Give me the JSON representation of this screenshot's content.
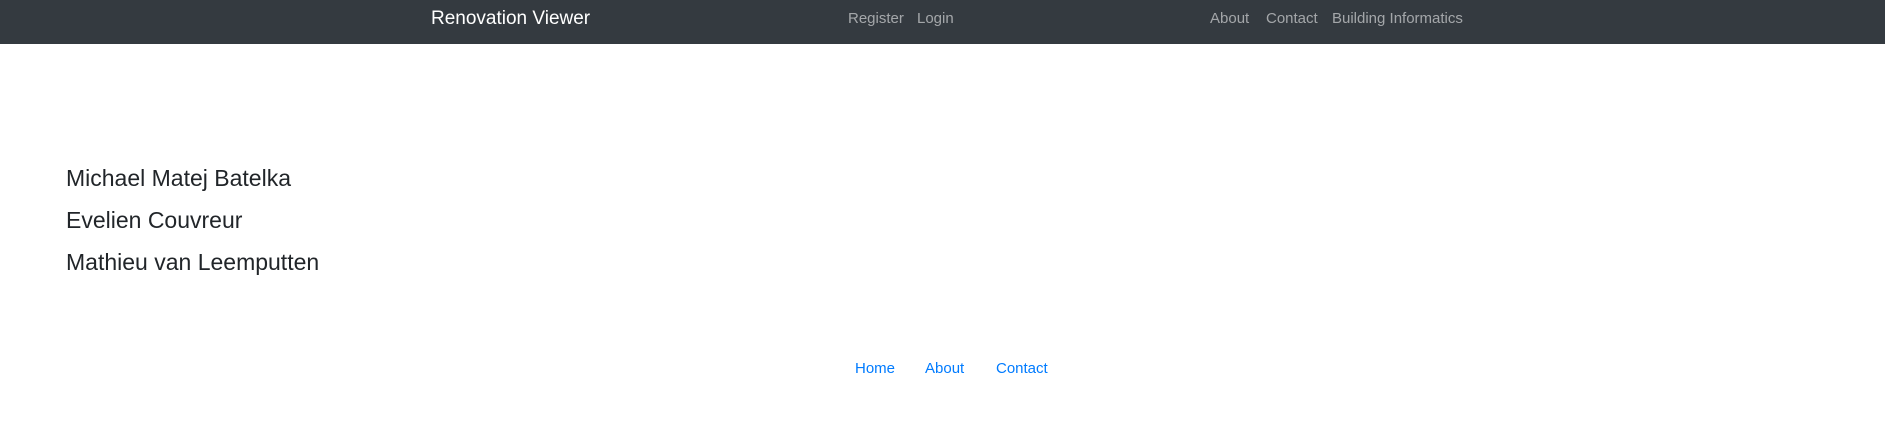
{
  "navbar": {
    "brand": "Renovation Viewer",
    "auth_links": [
      "Register",
      "Login"
    ],
    "links": [
      "About",
      "Contact",
      "Building Informatics"
    ]
  },
  "main": {
    "people": [
      "Michael Matej Batelka",
      "Evelien Couvreur",
      "Mathieu van Leemputten"
    ]
  },
  "footer": {
    "links": [
      "Home",
      "About",
      "Contact"
    ]
  }
}
